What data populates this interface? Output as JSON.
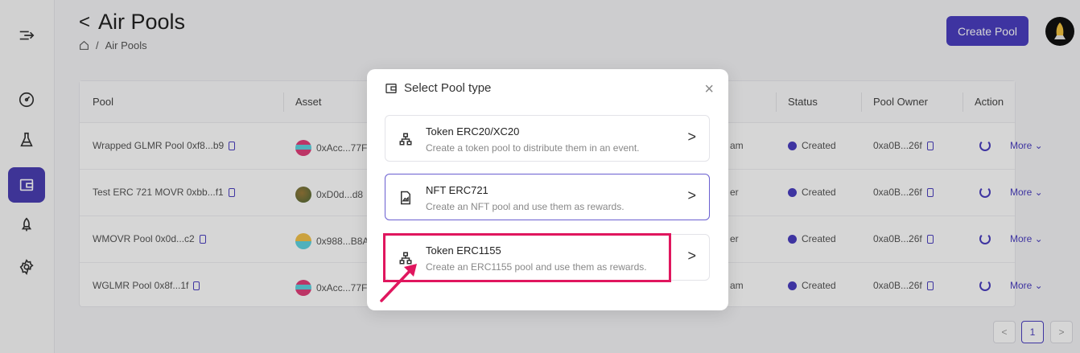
{
  "header": {
    "back_glyph": "<",
    "title": "Air Pools",
    "breadcrumb": [
      "Air Pools"
    ]
  },
  "toolbar": {
    "create_label": "Create Pool"
  },
  "table": {
    "columns": [
      "Pool",
      "Asset",
      "Status",
      "Pool Owner",
      "Action"
    ],
    "rows": [
      {
        "pool": "Wrapped GLMR Pool 0xf8...b9",
        "asset": "0xAcc...77F",
        "type": "am",
        "status": "Created",
        "owner": "0xa0B...26f",
        "more": "More ⌄"
      },
      {
        "pool": "Test ERC 721 MOVR 0xbb...f1",
        "asset": "0xD0d...d8",
        "type": "er",
        "status": "Created",
        "owner": "0xa0B...26f",
        "more": "More ⌄"
      },
      {
        "pool": "WMOVR Pool 0x0d...c2",
        "asset": "0x988...B8A",
        "type": "er",
        "status": "Created",
        "owner": "0xa0B...26f",
        "more": "More ⌄"
      },
      {
        "pool": "WGLMR Pool 0x8f...1f",
        "asset": "0xAcc...77F",
        "type": "am",
        "status": "Created",
        "owner": "0xa0B...26f",
        "more": "More ⌄"
      }
    ]
  },
  "pagination": {
    "prev": "<",
    "current": "1",
    "next": ">"
  },
  "modal": {
    "title": "Select Pool type",
    "close": "×",
    "options": [
      {
        "title": "Token ERC20/XC20",
        "desc": "Create a token pool to distribute them in an event.",
        "icon": "sitemap-icon"
      },
      {
        "title": "NFT ERC721",
        "desc": "Create an NFT pool and use them as rewards.",
        "icon": "file-image-icon"
      },
      {
        "title": "Token ERC1155",
        "desc": "Create an ERC1155 pool and use them as rewards.",
        "icon": "sitemap-icon"
      }
    ],
    "chevron": ">"
  },
  "colors": {
    "accent": "#4b3fc0",
    "highlight": "#e0165e"
  }
}
